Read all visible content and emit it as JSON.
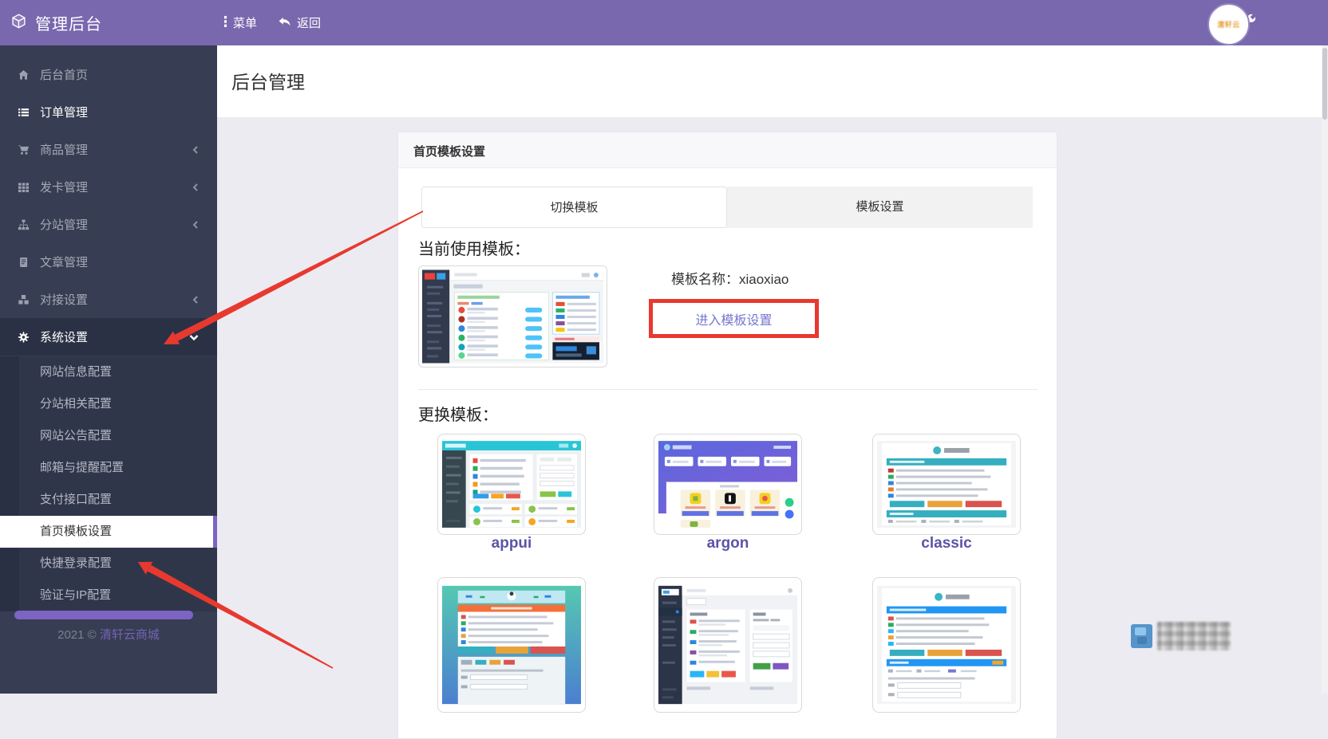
{
  "colors": {
    "header_purple": "#7968ae",
    "sidebar_dark": "#373d52",
    "annotation_red": "#e8392f",
    "link_purple": "#7577d0",
    "template_label_purple": "#5b54a7",
    "scroll_pill_purple": "#7d64c3"
  },
  "header": {
    "app_title": "管理后台",
    "menu_label": "菜单",
    "back_label": "返回",
    "avatar_text": "清轩云"
  },
  "sidebar": {
    "items": [
      {
        "label": "后台首页"
      },
      {
        "label": "订单管理"
      },
      {
        "label": "商品管理"
      },
      {
        "label": "发卡管理"
      },
      {
        "label": "分站管理"
      },
      {
        "label": "文章管理"
      },
      {
        "label": "对接设置"
      },
      {
        "label": "系统设置"
      }
    ],
    "submenu": [
      {
        "label": "网站信息配置"
      },
      {
        "label": "分站相关配置"
      },
      {
        "label": "网站公告配置"
      },
      {
        "label": "邮箱与提醒配置"
      },
      {
        "label": "支付接口配置"
      },
      {
        "label": "首页模板设置"
      },
      {
        "label": "快捷登录配置"
      },
      {
        "label": "验证与IP配置"
      }
    ],
    "footer_year": "2021 ©",
    "footer_brand": "清轩云商城"
  },
  "main": {
    "page_title": "后台管理",
    "card_header": "首页模板设置",
    "tabs": [
      {
        "label": "切换模板"
      },
      {
        "label": "模板设置"
      }
    ],
    "current_template_label": "当前使用模板：",
    "template_name": "模板名称：xiaoxiao",
    "enter_template_settings": "进入模板设置",
    "change_template_label": "更换模板：",
    "template_options": [
      {
        "name": "appui"
      },
      {
        "name": "argon"
      },
      {
        "name": "classic"
      }
    ]
  }
}
